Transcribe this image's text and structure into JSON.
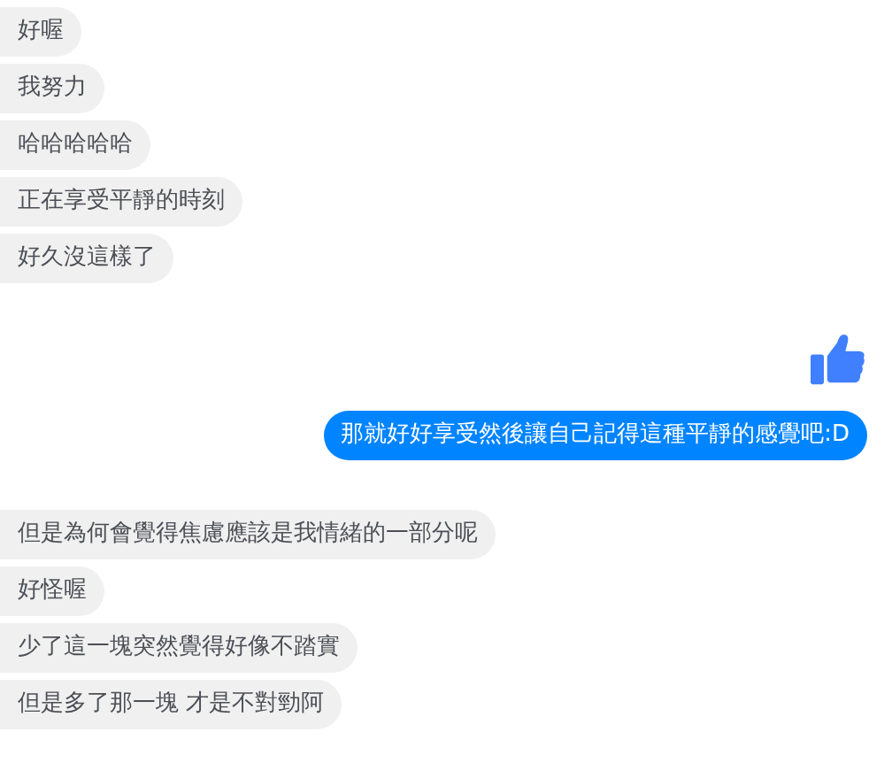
{
  "messages": [
    {
      "kind": "text",
      "outgoing": false,
      "text": "好喔"
    },
    {
      "kind": "text",
      "outgoing": false,
      "text": "我努力"
    },
    {
      "kind": "text",
      "outgoing": false,
      "text": "哈哈哈哈哈"
    },
    {
      "kind": "text",
      "outgoing": false,
      "text": "正在享受平靜的時刻"
    },
    {
      "kind": "text",
      "outgoing": false,
      "text": "好久沒這樣了"
    },
    {
      "kind": "like",
      "outgoing": true
    },
    {
      "kind": "text",
      "outgoing": true,
      "text": "那就好好享受然後讓自己記得這種平靜的感覺吧:D"
    },
    {
      "kind": "text",
      "outgoing": false,
      "text": "但是為何會覺得焦慮應該是我情緒的一部分呢"
    },
    {
      "kind": "text",
      "outgoing": false,
      "text": "好怪喔"
    },
    {
      "kind": "text",
      "outgoing": false,
      "text": "少了這一塊突然覺得好像不踏實"
    },
    {
      "kind": "text",
      "outgoing": false,
      "text": "但是多了那一塊 才是不對勁阿"
    }
  ]
}
